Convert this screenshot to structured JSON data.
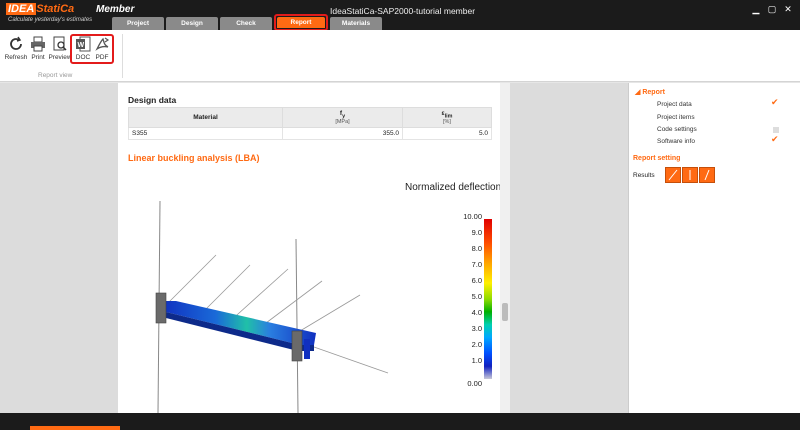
{
  "app": {
    "brand_idea": "IDEA",
    "brand_statica": "StatiCa",
    "product": "Member",
    "tagline": "Calculate yesterday's estimates",
    "window_title": "IdeaStatiCa-SAP2000-tutorial member"
  },
  "tabs": [
    {
      "label": "Project"
    },
    {
      "label": "Design"
    },
    {
      "label": "Check"
    },
    {
      "label": "Report"
    },
    {
      "label": "Materials"
    }
  ],
  "ribbon": {
    "refresh": "Refresh",
    "print": "Print",
    "preview": "Preview",
    "doc": "DOC",
    "pdf": "PDF",
    "group_label": "Report view"
  },
  "report": {
    "design_data_title": "Design data",
    "table": {
      "headers": {
        "material": "Material",
        "fy": "f",
        "fy_sub": "y",
        "fy_unit": "[MPa]",
        "elim": "ε",
        "elim_sub": "lim",
        "elim_unit": "[%]"
      },
      "rows": [
        {
          "material": "S355",
          "fy": "355.0",
          "elim": "5.0"
        }
      ]
    },
    "lba_title": "Linear buckling analysis (LBA)",
    "plot_title": "Normalized deflection",
    "legend": [
      "10.00",
      "9.0",
      "8.0",
      "7.0",
      "6.0",
      "5.0",
      "4.0",
      "3.0",
      "2.0",
      "1.0",
      "0.00"
    ]
  },
  "panel": {
    "root": "Report",
    "items": [
      {
        "label": "Project data",
        "checked": true
      },
      {
        "label": "Project items",
        "checked": false
      },
      {
        "label": "Code settings",
        "checked": false
      },
      {
        "label": "Software info",
        "checked": true
      }
    ],
    "setting_title": "Report setting",
    "results_label": "Results"
  },
  "colors": {
    "accent": "#ff6a13",
    "highlight": "#e31b1b"
  }
}
